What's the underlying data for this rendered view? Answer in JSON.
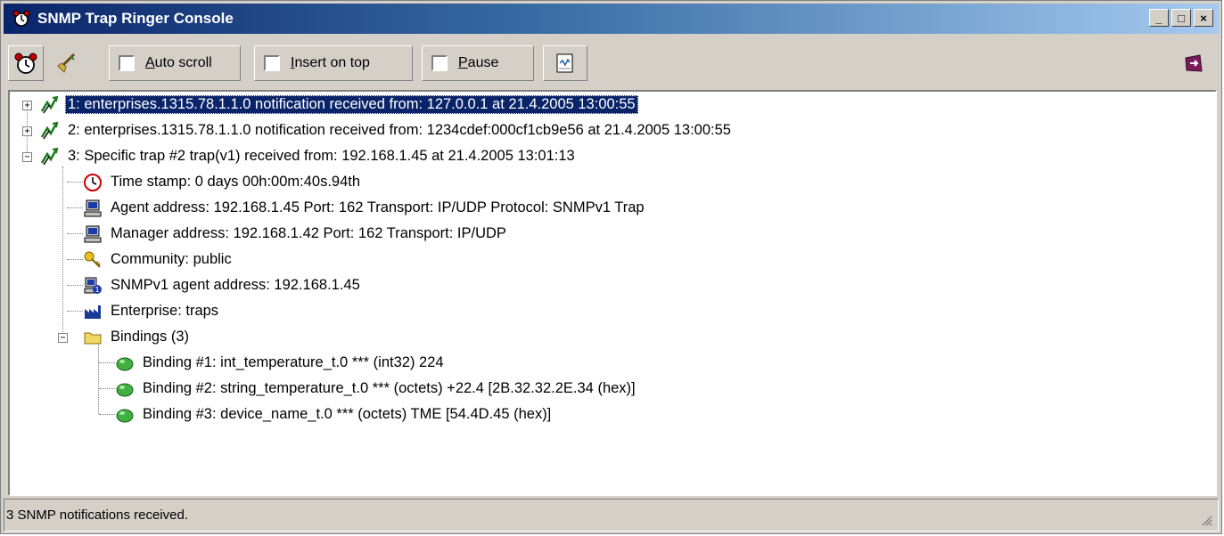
{
  "window": {
    "title": "SNMP Trap Ringer Console"
  },
  "title_buttons": {
    "minimize": "_",
    "maximize": "□",
    "close": "×"
  },
  "toolbar": {
    "auto_scroll": {
      "label_u": "A",
      "label_rest": "uto scroll",
      "checked": false
    },
    "insert_on_top": {
      "label_u": "I",
      "label_rest": "nsert on top",
      "checked": false
    },
    "pause": {
      "label_u": "P",
      "label_rest": "ause",
      "checked": false
    }
  },
  "tree": {
    "items": [
      {
        "label": "1: enterprises.1315.78.1.1.0 notification received from: 127.0.0.1 at 21.4.2005 13:00:55",
        "expander": "+",
        "selected": true
      },
      {
        "label": "2: enterprises.1315.78.1.1.0 notification received from: 1234cdef:000cf1cb9e56 at 21.4.2005 13:00:55",
        "expander": "+",
        "selected": false
      },
      {
        "label": "3: Specific trap #2 trap(v1) received from: 192.168.1.45 at 21.4.2005 13:01:13",
        "expander": "−",
        "selected": false
      },
      {
        "label": "Time stamp: 0 days 00h:00m:40s.94th",
        "icon": "clock-icon"
      },
      {
        "label": "Agent address: 192.168.1.45 Port: 162 Transport: IP/UDP Protocol: SNMPv1 Trap",
        "icon": "agent-computer-icon"
      },
      {
        "label": "Manager address: 192.168.1.42 Port: 162 Transport: IP/UDP",
        "icon": "manager-computer-icon"
      },
      {
        "label": "Community: public",
        "icon": "key-icon"
      },
      {
        "label": "SNMPv1 agent address: 192.168.1.45",
        "icon": "snmp-agent-icon"
      },
      {
        "label": "Enterprise: traps",
        "icon": "enterprise-factory-icon"
      },
      {
        "label": "Bindings (3)",
        "icon": "folder-icon",
        "expander": "−"
      },
      {
        "label": "Binding #1: int_temperature_t.0 *** (int32) 224",
        "icon": "binding-icon"
      },
      {
        "label": "Binding #2: string_temperature_t.0 *** (octets) +22.4 [2B.32.32.2E.34 (hex)]",
        "icon": "binding-icon"
      },
      {
        "label": "Binding #3: device_name_t.0 *** (octets) TME [54.4D.45 (hex)]",
        "icon": "binding-icon"
      }
    ]
  },
  "status": {
    "text": "3 SNMP notifications received."
  },
  "colors": {
    "titlebar_start": "#0a246a",
    "titlebar_end": "#a6caf0",
    "selection": "#0a246a",
    "face": "#d4d0c8"
  }
}
